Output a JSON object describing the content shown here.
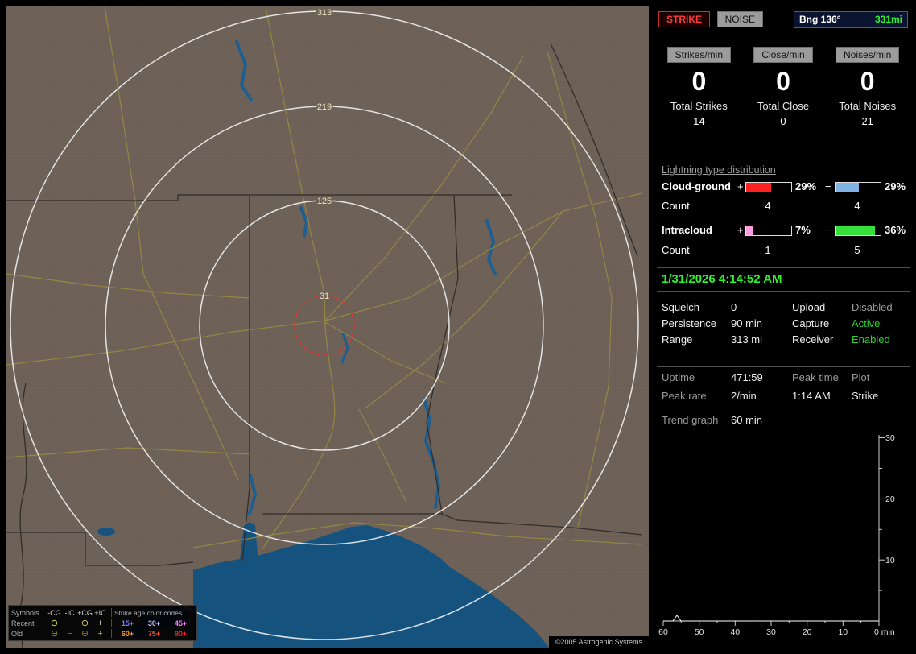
{
  "map": {
    "ring_labels": [
      "313",
      "219",
      "125",
      "31"
    ],
    "copyright": "©2005 Astrogenic Systems",
    "legend": {
      "symbols_header": "Symbols",
      "col_headers": [
        "-CG",
        "-IC",
        "+CG",
        "+IC"
      ],
      "age_header": "Strike age color codes",
      "rows": [
        {
          "label": "Recent",
          "symbols": [
            {
              "glyph": "⊖",
              "style": "color:#d6e34a"
            },
            {
              "glyph": "−",
              "style": "color:#9fe34a"
            },
            {
              "glyph": "⊕",
              "style": "color:#e3d34a"
            },
            {
              "glyph": "+",
              "style": "color:#e9e9c9"
            }
          ],
          "ages": [
            {
              "text": "15+",
              "style": "color:#7b7bff"
            },
            {
              "text": "30+",
              "style": "color:#c3c3ff"
            },
            {
              "text": "45+",
              "style": "color:#ff7bff"
            }
          ]
        },
        {
          "label": "Old",
          "symbols": [
            {
              "glyph": "⊖",
              "style": "color:#8f8f23"
            },
            {
              "glyph": "−",
              "style": "color:#6f8f23"
            },
            {
              "glyph": "⊕",
              "style": "color:#8f7f23"
            },
            {
              "glyph": "+",
              "style": "color:#9f9f7f"
            }
          ],
          "ages": [
            {
              "text": "60+",
              "style": "color:#ff9832"
            },
            {
              "text": "75+",
              "style": "color:#ff5532"
            },
            {
              "text": "90+",
              "style": "color:#ff2222"
            }
          ]
        }
      ]
    }
  },
  "sidebar": {
    "modes": {
      "strike": "STRIKE",
      "noise": "NOISE"
    },
    "bearing": {
      "label": "Bng 136°",
      "range": "331mi"
    },
    "columns": [
      {
        "header": "Strikes/min",
        "rate": "0",
        "total_label": "Total Strikes",
        "total": "14"
      },
      {
        "header": "Close/min",
        "rate": "0",
        "total_label": "Total Close",
        "total": "0"
      },
      {
        "header": "Noises/min",
        "rate": "0",
        "total_label": "Total Noises",
        "total": "21"
      }
    ],
    "distribution": {
      "title": "Lightning type distribution",
      "count_label": "Count",
      "rows": [
        {
          "label": "Cloud-ground",
          "plus": "+",
          "minus": "−",
          "pos_pct": "29%",
          "neg_pct": "29%",
          "pos_count": "4",
          "neg_count": "4",
          "pos_fill": "width:55%;background:#ff2222",
          "neg_fill": "width:52%;background:#7fb2e5"
        },
        {
          "label": "Intracloud",
          "plus": "+",
          "minus": "−",
          "pos_pct": "7%",
          "neg_pct": "36%",
          "pos_count": "1",
          "neg_count": "5",
          "pos_fill": "width:14%;background:#ff9ce0",
          "neg_fill": "width:88%;background:#35e03a"
        }
      ]
    },
    "datetime": "1/31/2026 4:14:52 AM",
    "settings": [
      {
        "l1": "Squelch",
        "v1": "0",
        "l2": "Upload",
        "v2": "Disabled",
        "v2_style": "color:#9a9a9a"
      },
      {
        "l1": "Persistence",
        "v1": "90 min",
        "l2": "Capture",
        "v2": "Active",
        "v2_style": "color:#2ecc2e"
      },
      {
        "l1": "Range",
        "v1": "313 mi",
        "l2": "Receiver",
        "v2": "Enabled",
        "v2_style": "color:#2ecc2e"
      }
    ],
    "status": {
      "uptime_label": "Uptime",
      "uptime": "471:59",
      "peaktime_label": "Peak time",
      "plot_label": "Plot",
      "peakrate_label": "Peak rate",
      "peakrate": "2/min",
      "peaktime": "1:14 AM",
      "plot": "Strike",
      "trend_label": "Trend graph",
      "trend": "60 min"
    },
    "chart": {
      "y_ticks": [
        "30",
        "20",
        "10"
      ],
      "x_ticks": [
        "60",
        "50",
        "40",
        "30",
        "20",
        "10",
        "0 min"
      ]
    }
  }
}
